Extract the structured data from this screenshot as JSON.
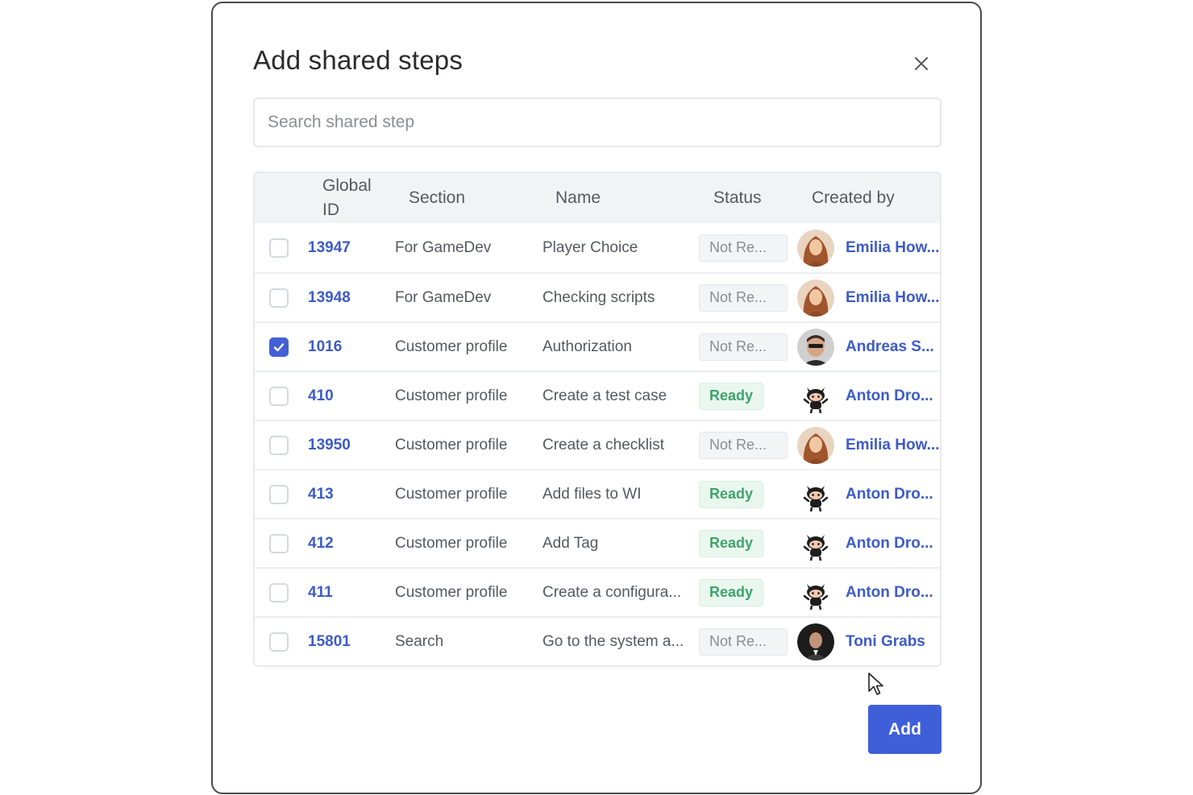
{
  "dialog": {
    "title": "Add shared steps",
    "close_icon": "close-icon",
    "search_placeholder": "Search shared step",
    "search_value": "",
    "add_label": "Add"
  },
  "table": {
    "headers": {
      "global_id_line1": "Global",
      "global_id_line2": "ID",
      "section": "Section",
      "name": "Name",
      "status": "Status",
      "created_by": "Created by"
    },
    "rows": [
      {
        "checked": false,
        "id": "13947",
        "section": "For GameDev",
        "name": "Player Choice",
        "status": "Not Re...",
        "status_type": "notready",
        "creator": "Emilia How...",
        "avatar": "woman-avatar"
      },
      {
        "checked": false,
        "id": "13948",
        "section": "For GameDev",
        "name": "Checking scripts",
        "status": "Not Re...",
        "status_type": "notready",
        "creator": "Emilia How...",
        "avatar": "woman-avatar"
      },
      {
        "checked": true,
        "id": "1016",
        "section": "Customer profile",
        "name": "Authorization",
        "status": "Not Re...",
        "status_type": "notready",
        "creator": "Andreas S...",
        "avatar": "man-avatar"
      },
      {
        "checked": false,
        "id": "410",
        "section": "Customer profile",
        "name": "Create a test case",
        "status": "Ready",
        "status_type": "ready",
        "creator": "Anton Dro...",
        "avatar": "octocat-avatar"
      },
      {
        "checked": false,
        "id": "13950",
        "section": "Customer profile",
        "name": "Create a checklist",
        "status": "Not Re...",
        "status_type": "notready",
        "creator": "Emilia How...",
        "avatar": "woman-avatar"
      },
      {
        "checked": false,
        "id": "413",
        "section": "Customer profile",
        "name": "Add files to WI",
        "status": "Ready",
        "status_type": "ready",
        "creator": "Anton Dro...",
        "avatar": "octocat-avatar"
      },
      {
        "checked": false,
        "id": "412",
        "section": "Customer profile",
        "name": "Add Tag",
        "status": "Ready",
        "status_type": "ready",
        "creator": "Anton Dro...",
        "avatar": "octocat-avatar"
      },
      {
        "checked": false,
        "id": "411",
        "section": "Customer profile",
        "name": "Create a configura...",
        "status": "Ready",
        "status_type": "ready",
        "creator": "Anton Dro...",
        "avatar": "octocat-avatar"
      },
      {
        "checked": false,
        "id": "15801",
        "section": "Search",
        "name": "Go to the system a...",
        "status": "Not Re...",
        "status_type": "notready",
        "creator": "Toni Grabs",
        "avatar": "man-dark-avatar"
      }
    ]
  },
  "colors": {
    "accent": "#3f5fd8",
    "link": "#3d5bc6",
    "ready_text": "#3fa36b",
    "ready_bg": "#eaf7ef"
  }
}
